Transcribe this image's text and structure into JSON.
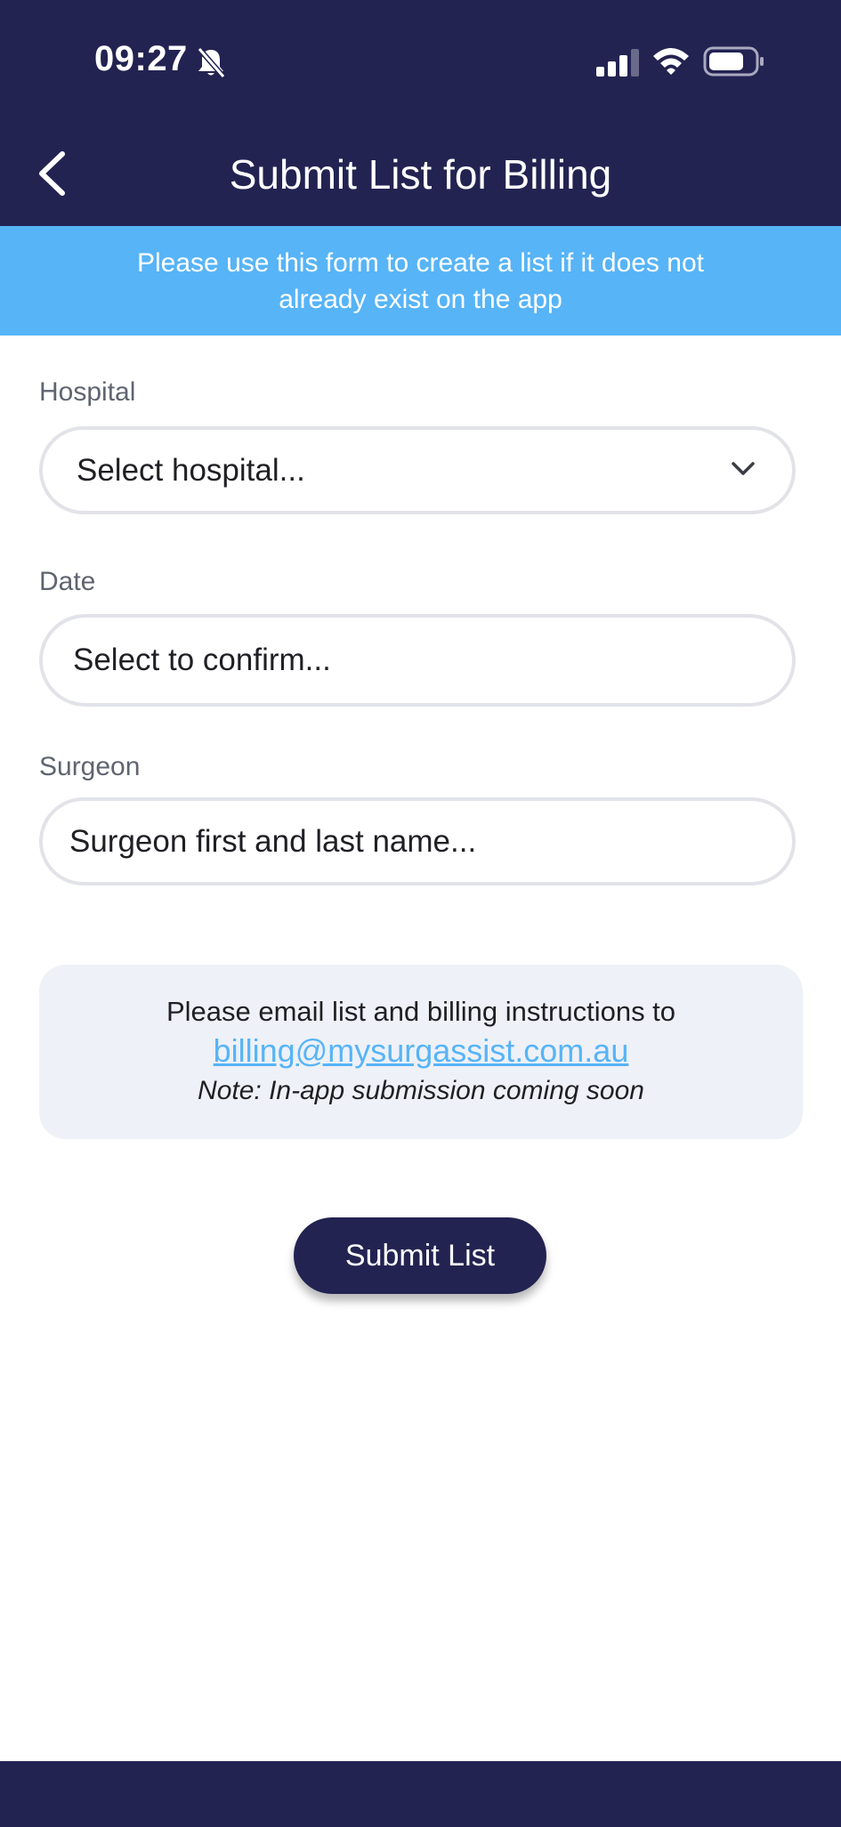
{
  "status_bar": {
    "time": "09:27",
    "icons": [
      "bell-slash-icon",
      "signal-icon",
      "wifi-icon",
      "battery-icon"
    ]
  },
  "header": {
    "title": "Submit List for Billing",
    "back_icon": "chevron-left-icon"
  },
  "banner": {
    "text": "Please use this form to create a list if it does not already exist on the app"
  },
  "form": {
    "hospital": {
      "label": "Hospital",
      "value": "Select hospital...",
      "icon": "chevron-down-icon"
    },
    "date": {
      "label": "Date",
      "value": "Select to confirm..."
    },
    "surgeon": {
      "label": "Surgeon",
      "placeholder": "Surgeon first and last name..."
    }
  },
  "email_card": {
    "line1": "Please email list and billing instructions to",
    "email": "billing@mysurgassist.com.au",
    "note": "Note: In-app submission coming soon"
  },
  "submit_button": {
    "label": "Submit List"
  },
  "colors": {
    "navy": "#232352",
    "banner_blue": "#57b4f7",
    "card_bg": "#eef1f7",
    "field_border": "#e2e3e8",
    "label_gray": "#5f6470"
  }
}
